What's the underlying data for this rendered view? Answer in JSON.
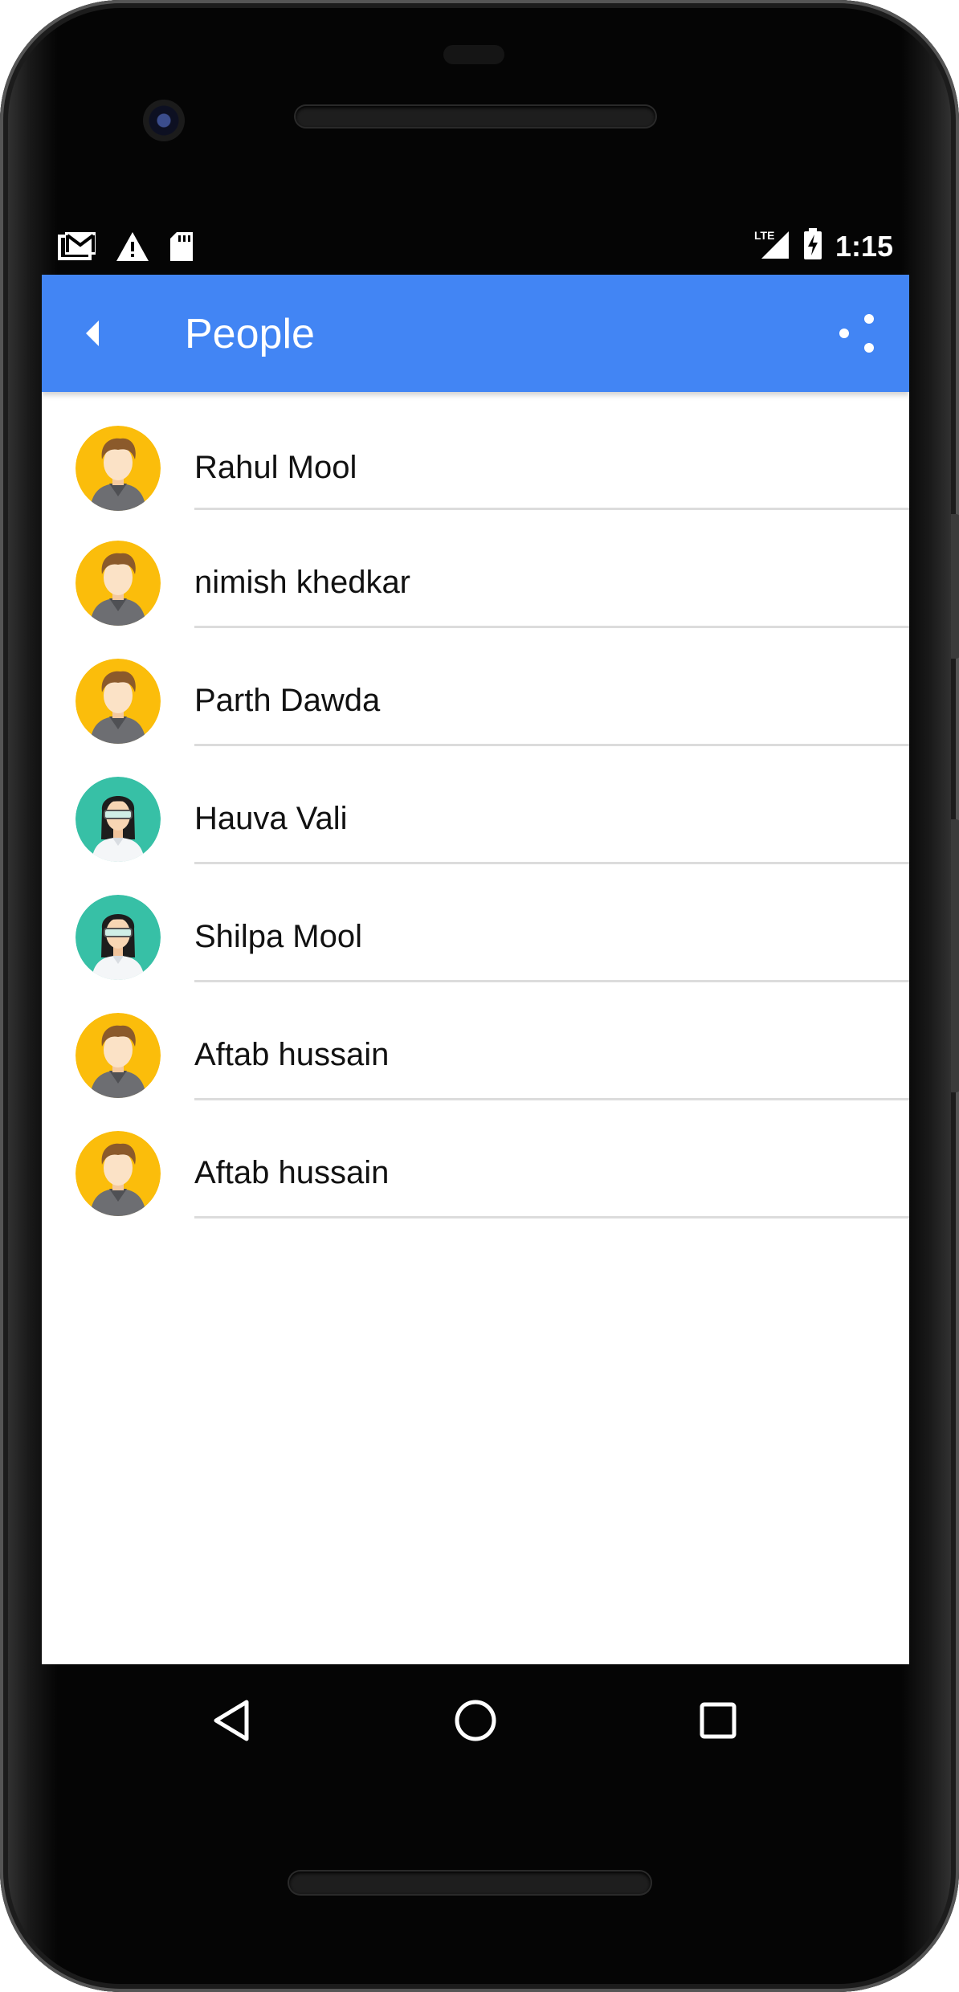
{
  "status_bar": {
    "time": "1:15",
    "network_label": "LTE",
    "left_icons": [
      "gmail-icon",
      "warning-icon",
      "sd-card-icon"
    ],
    "right_icons": [
      "signal-icon",
      "battery-charging-icon"
    ]
  },
  "app_bar": {
    "title": "People",
    "color": "#4285f4",
    "back_icon": "back-arrow-icon",
    "action_icon": "share-icon"
  },
  "people": [
    {
      "name": "Rahul Mool",
      "avatar": "male"
    },
    {
      "name": "nimish khedkar",
      "avatar": "male"
    },
    {
      "name": "Parth Dawda",
      "avatar": "male"
    },
    {
      "name": "Hauva Vali",
      "avatar": "female"
    },
    {
      "name": "Shilpa Mool",
      "avatar": "female"
    },
    {
      "name": "Aftab hussain",
      "avatar": "male"
    },
    {
      "name": "Aftab hussain",
      "avatar": "male"
    }
  ],
  "avatar_colors": {
    "male": "#fbbd0b",
    "female": "#37c0a6"
  },
  "nav_bar": {
    "icons": [
      "nav-back-icon",
      "nav-home-icon",
      "nav-recents-icon"
    ]
  }
}
